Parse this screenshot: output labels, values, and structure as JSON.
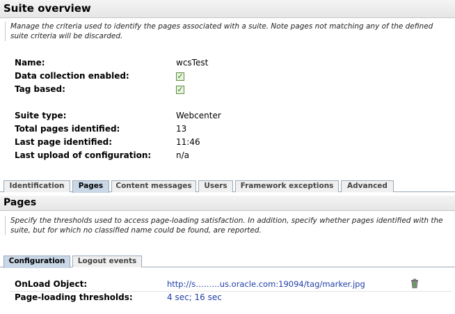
{
  "overview": {
    "title": "Suite overview",
    "description": "Manage the criteria used to identify the pages associated with a suite. Note pages not matching any of the defined suite criteria will be discarded.",
    "fields": {
      "name": {
        "label": "Name:",
        "value": "wcsTest"
      },
      "data_collection": {
        "label": "Data collection enabled:",
        "checked": true
      },
      "tag_based": {
        "label": "Tag based:",
        "checked": true
      },
      "suite_type": {
        "label": "Suite type:",
        "value": "Webcenter"
      },
      "total_pages": {
        "label": "Total pages identified:",
        "value": "13"
      },
      "last_page": {
        "label": "Last page identified:",
        "value": "11:46"
      },
      "last_upload": {
        "label": "Last upload of configuration:",
        "value": "n/a"
      }
    }
  },
  "tabs": {
    "identification": "Identification",
    "pages": "Pages",
    "content_messages": "Content messages",
    "users": "Users",
    "framework_exceptions": "Framework exceptions",
    "advanced": "Advanced",
    "active": "Pages"
  },
  "pages": {
    "title": "Pages",
    "description": "Specify the thresholds used to access page-loading satisfaction. In addition, specify whether pages identified with the suite, but for which no classified name could be found, are reported.",
    "subtabs": {
      "configuration": "Configuration",
      "logout_events": "Logout events",
      "active": "Configuration"
    },
    "onload": {
      "label": "OnLoad Object:",
      "value": "http://s………us.oracle.com:19094/tag/marker.jpg"
    },
    "thresholds": {
      "label": "Page-loading thresholds:",
      "value": "4 sec; 16 sec"
    }
  },
  "colors": {
    "link": "#1f3fa8",
    "active_tab": "#c9d7e6",
    "check": "#2e7d16"
  }
}
